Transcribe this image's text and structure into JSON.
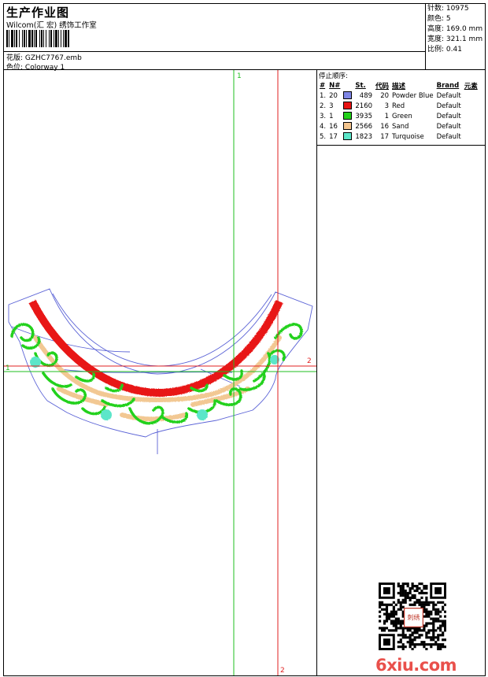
{
  "header": {
    "title": "生产作业图",
    "company": "Wilcom(汇 宏) 绣饰工作室",
    "design_label": "花版:",
    "design_value": "GZHC7767.emb",
    "colorway_label": "色位:",
    "colorway_value": "Colorway 1"
  },
  "stats": [
    {
      "label": "针数:",
      "value": "10975"
    },
    {
      "label": "颜色:",
      "value": "5"
    },
    {
      "label": "高度:",
      "value": "169.0 mm"
    },
    {
      "label": "宽度:",
      "value": "321.1 mm"
    },
    {
      "label": "比例:",
      "value": "0.41"
    }
  ],
  "stop_sequence": {
    "title": "停止顺序:",
    "headers": [
      "#",
      "N#",
      "St.",
      "代码",
      "描述",
      "Brand",
      "元素"
    ],
    "rows": [
      {
        "idx": "1.",
        "n": "20",
        "color": "#7f86e6",
        "st": "489",
        "code": "20",
        "desc": "Powder Blue",
        "brand": "Default"
      },
      {
        "idx": "2.",
        "n": "3",
        "color": "#e81313",
        "st": "2160",
        "code": "3",
        "desc": "Red",
        "brand": "Default"
      },
      {
        "idx": "3.",
        "n": "1",
        "color": "#22d11a",
        "st": "3935",
        "code": "1",
        "desc": "Green",
        "brand": "Default"
      },
      {
        "idx": "4.",
        "n": "16",
        "color": "#f4c58e",
        "st": "2566",
        "code": "16",
        "desc": "Sand",
        "brand": "Default"
      },
      {
        "idx": "5.",
        "n": "17",
        "color": "#5be6c9",
        "st": "1823",
        "code": "17",
        "desc": "Turquoise",
        "brand": "Default"
      }
    ]
  },
  "guides": {
    "green_label_top": "1",
    "green_label_left": "1",
    "red_label_right": "2",
    "red_label_bottom": "2",
    "green_color": "#1fbf1f",
    "red_color": "#e02020"
  },
  "design_colors": {
    "outline": "#5b63d6",
    "red_band": "#e81313",
    "green_scroll": "#22d11a",
    "sand_fill": "#f2c893",
    "turquoise_dot": "#5be6c9"
  },
  "watermark": {
    "text": "6xiu.com",
    "seal": "刺绣"
  }
}
